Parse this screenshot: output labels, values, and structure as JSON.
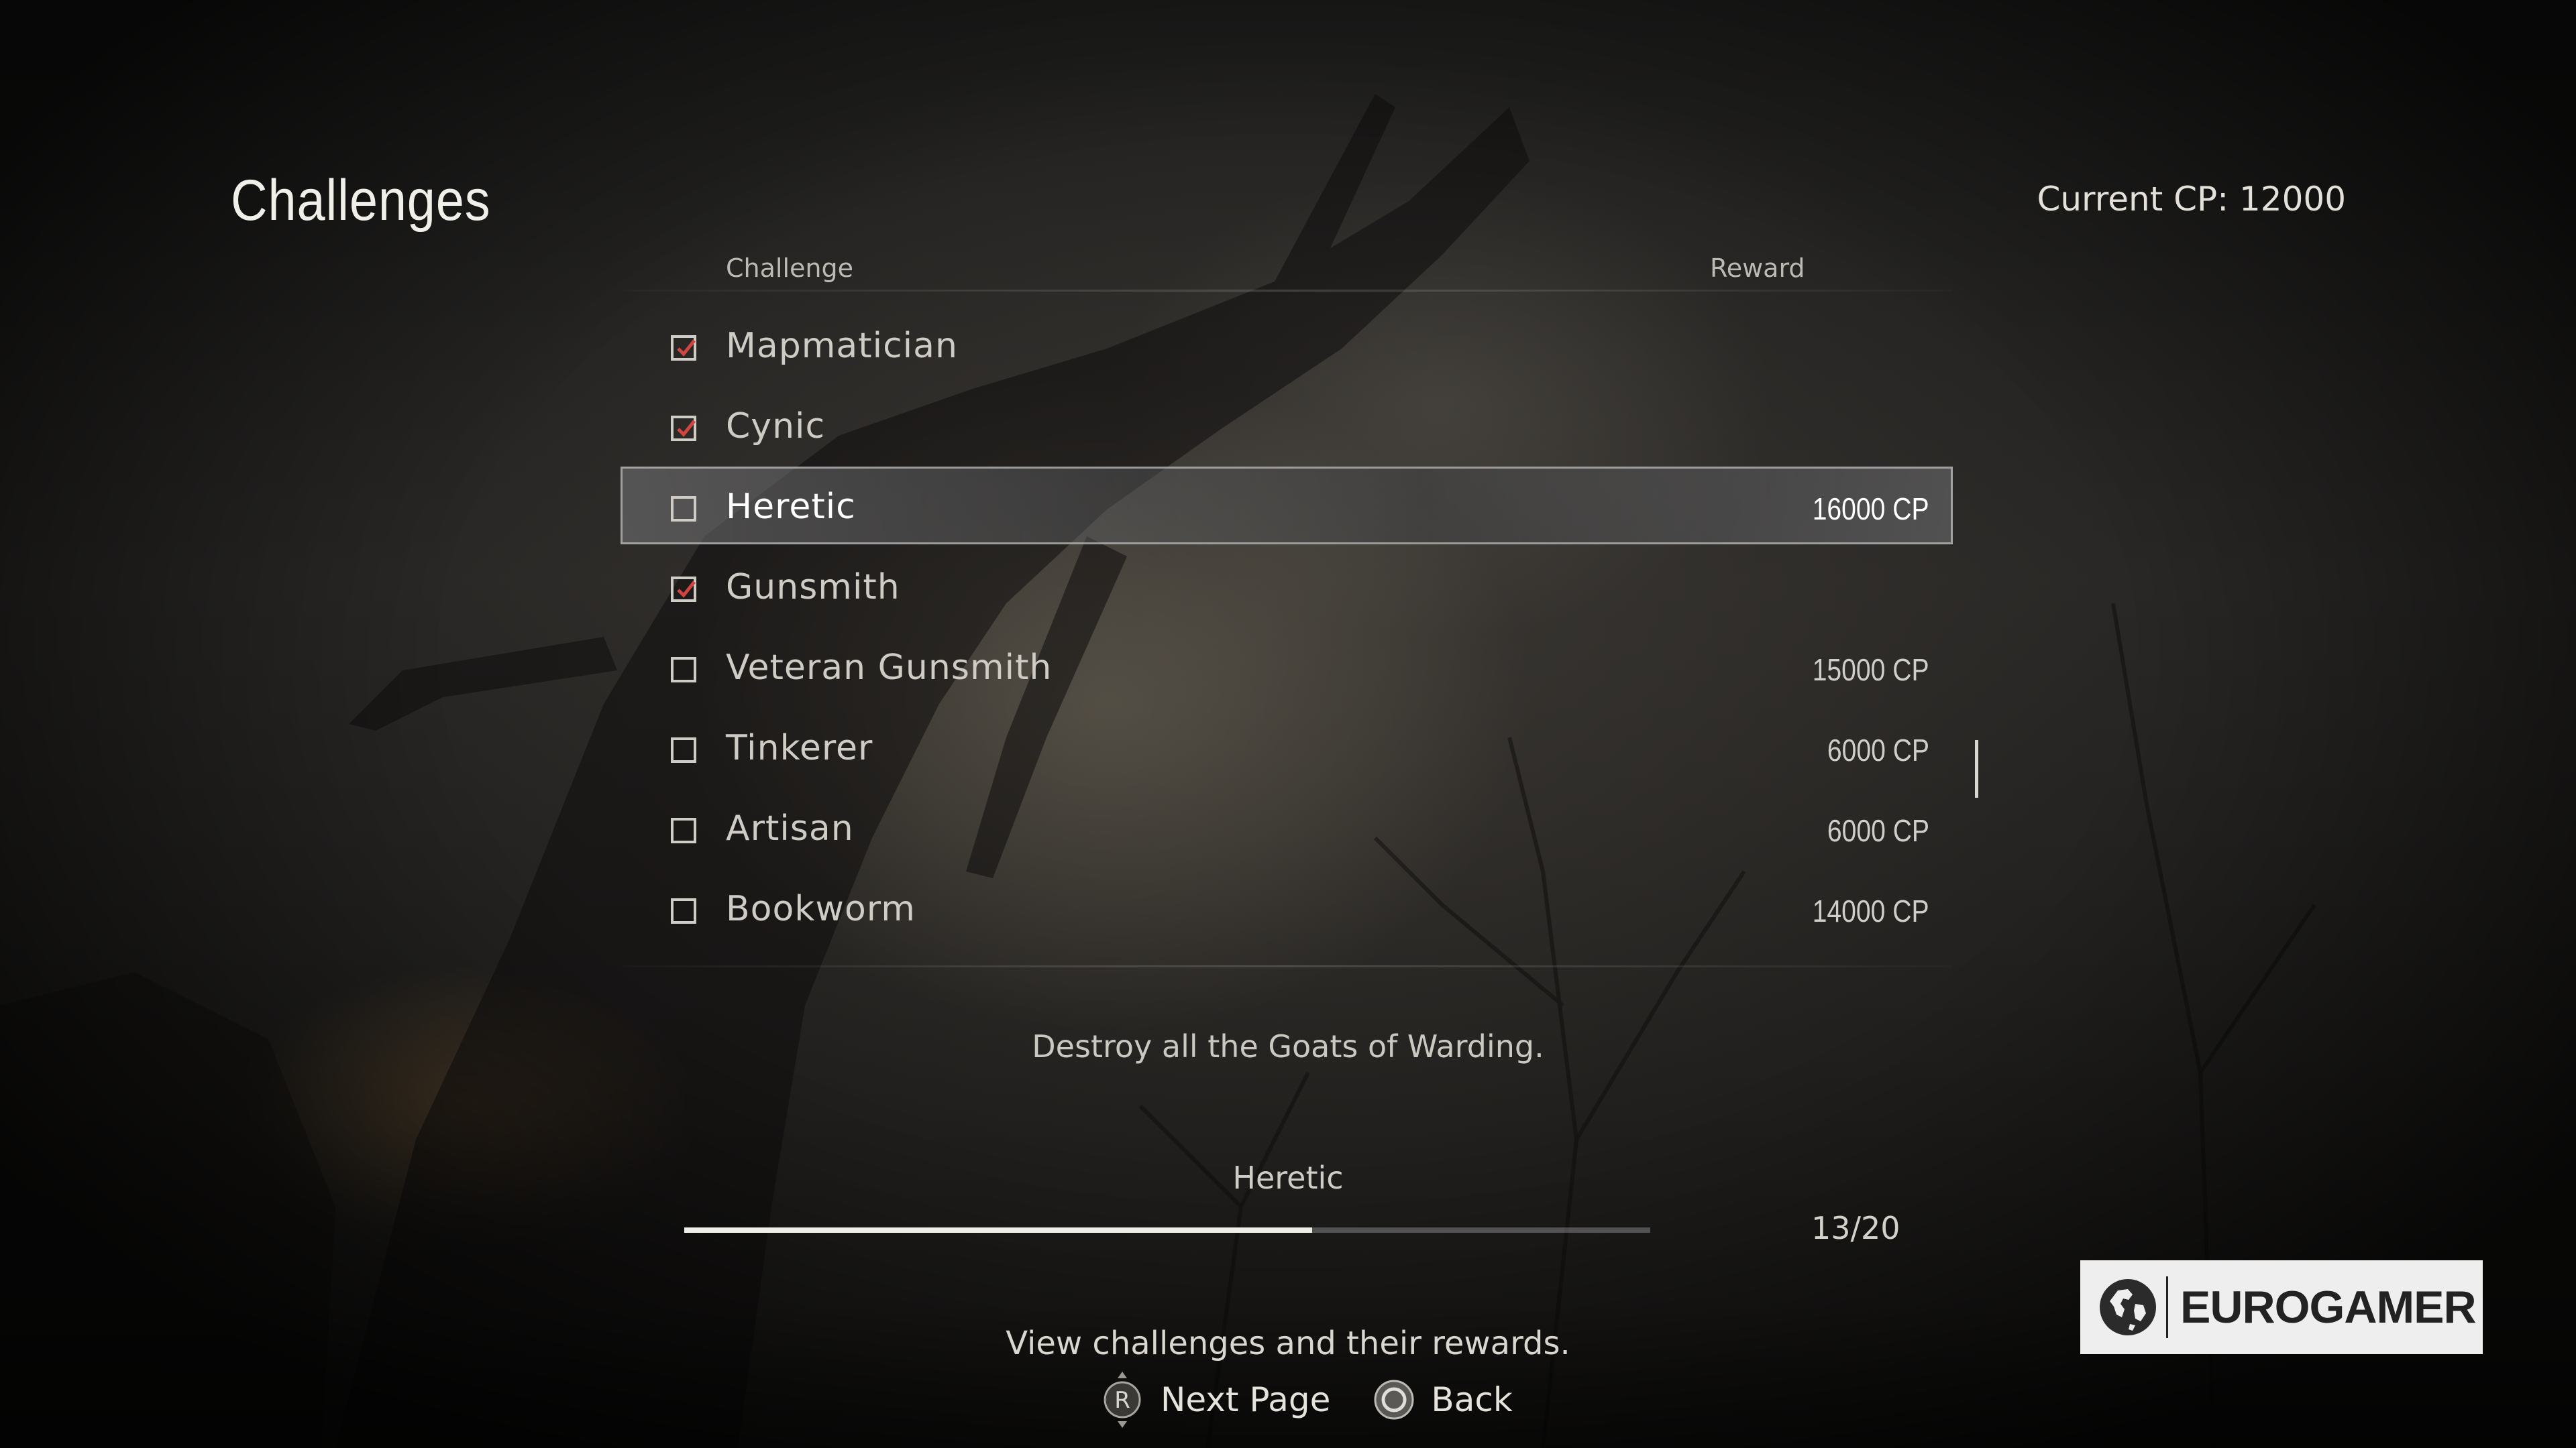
{
  "screen": {
    "title": "Challenges",
    "current_cp": "Current CP: 12000"
  },
  "table": {
    "headers": {
      "challenge": "Challenge",
      "reward": "Reward"
    },
    "rows": [
      {
        "name": "Mapmatician",
        "reward": "",
        "completed": true,
        "selected": false
      },
      {
        "name": "Cynic",
        "reward": "",
        "completed": true,
        "selected": false
      },
      {
        "name": "Heretic",
        "reward": "16000 CP",
        "completed": false,
        "selected": true
      },
      {
        "name": "Gunsmith",
        "reward": "",
        "completed": true,
        "selected": false
      },
      {
        "name": "Veteran Gunsmith",
        "reward": "15000 CP",
        "completed": false,
        "selected": false
      },
      {
        "name": "Tinkerer",
        "reward": "6000 CP",
        "completed": false,
        "selected": false
      },
      {
        "name": "Artisan",
        "reward": "6000 CP",
        "completed": false,
        "selected": false
      },
      {
        "name": "Bookworm",
        "reward": "14000 CP",
        "completed": false,
        "selected": false
      }
    ]
  },
  "detail": {
    "description": "Destroy all the Goats of Warding.",
    "progress_label": "Heretic",
    "progress_text": "13/20",
    "progress_fraction": 0.65
  },
  "footer": {
    "help_text": "View challenges and their rewards.",
    "next_page_label": "Next Page",
    "back_label": "Back",
    "next_page_button_glyph": "R"
  },
  "watermark": {
    "text": "EUROGAMER"
  },
  "colors": {
    "check": "#d0453f",
    "highlight_border": "#cdcdcd"
  },
  "icons": {
    "completed": "checked-box-icon",
    "incomplete": "empty-box-icon",
    "next_page": "right-stick-icon",
    "back": "circle-button-icon"
  }
}
